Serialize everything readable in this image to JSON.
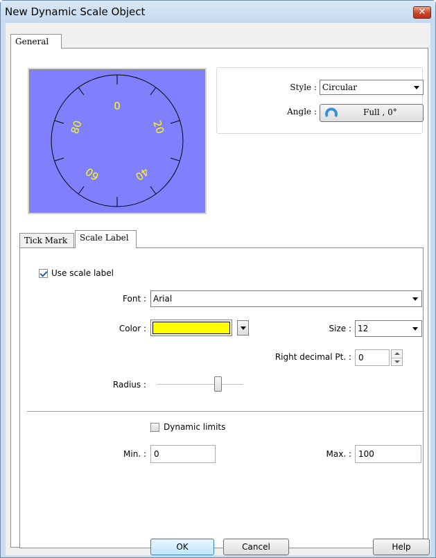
{
  "window": {
    "title": "New Dynamic Scale Object",
    "close_glyph": "✕"
  },
  "tabs": {
    "general": "General",
    "tick_mark": "Tick Mark",
    "scale_label": "Scale Label"
  },
  "preview": {
    "background_color": "#8080ff",
    "label_color": "#ffff00",
    "labels": [
      "0",
      "20",
      "40",
      "60",
      "80"
    ]
  },
  "style_group": {
    "style_label": "Style :",
    "style_value": "Circular",
    "angle_label": "Angle :",
    "angle_value": "Full , 0°"
  },
  "scale_label": {
    "use_scale_label": "Use scale label",
    "use_scale_label_checked": true,
    "font_label": "Font :",
    "font_value": "Arial",
    "color_label": "Color :",
    "color_value": "#ffff00",
    "size_label": "Size :",
    "size_value": "12",
    "right_decimal_label": "Right decimal Pt. :",
    "right_decimal_value": "0",
    "radius_label": "Radius :",
    "radius_level": 0.7
  },
  "limits": {
    "dynamic_limits": "Dynamic limits",
    "dynamic_limits_checked": false,
    "min_label": "Min. :",
    "min_value": "0",
    "max_label": "Max. :",
    "max_value": "100"
  },
  "buttons": {
    "ok": "OK",
    "cancel": "Cancel",
    "help": "Help"
  }
}
